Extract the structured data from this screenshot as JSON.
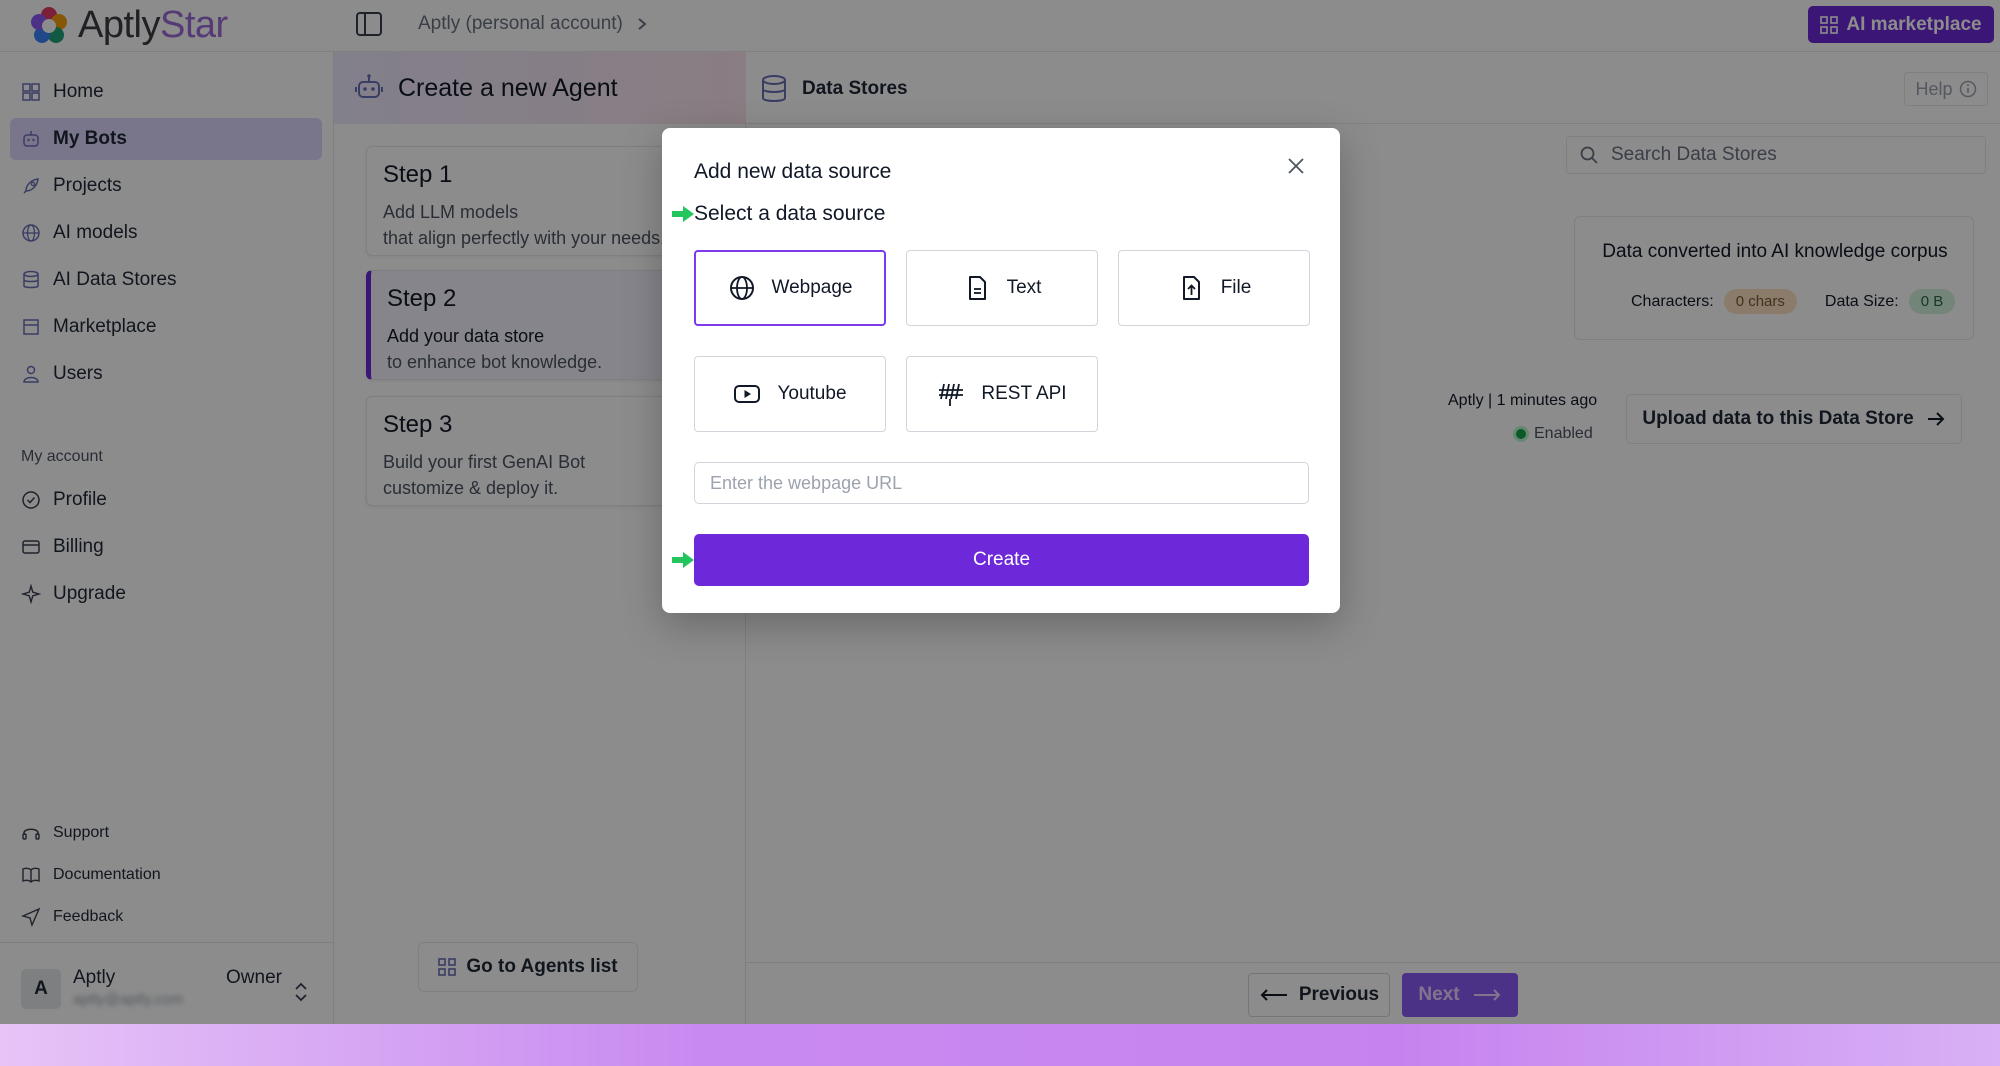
{
  "app": {
    "logo_text_main": "Aptly",
    "logo_text_accent": "Star",
    "breadcrumb": "Aptly (personal account)",
    "ai_marketplace_label": "AI marketplace"
  },
  "sidebar": {
    "items": [
      {
        "label": "Home",
        "icon": "home-icon"
      },
      {
        "label": "My Bots",
        "icon": "bot-icon",
        "active": true
      },
      {
        "label": "Projects",
        "icon": "rocket-icon"
      },
      {
        "label": "AI models",
        "icon": "globe-icon"
      },
      {
        "label": "AI Data Stores",
        "icon": "database-icon"
      },
      {
        "label": "Marketplace",
        "icon": "store-icon"
      },
      {
        "label": "Users",
        "icon": "user-icon"
      }
    ],
    "account_section_label": "My account",
    "account_items": [
      {
        "label": "Profile",
        "icon": "profile-icon"
      },
      {
        "label": "Billing",
        "icon": "card-icon"
      },
      {
        "label": "Upgrade",
        "icon": "sparkle-icon"
      }
    ],
    "footer_items": [
      {
        "label": "Support",
        "icon": "headset-icon"
      },
      {
        "label": "Documentation",
        "icon": "book-icon"
      },
      {
        "label": "Feedback",
        "icon": "send-icon"
      }
    ],
    "user": {
      "initial": "A",
      "name": "Aptly",
      "email": "aptly@aptly.com",
      "role": "Owner"
    }
  },
  "agent": {
    "header": "Create a new Agent",
    "steps": [
      {
        "title": "Step 1",
        "line1": "Add LLM models",
        "line2": "that align perfectly with your needs."
      },
      {
        "title": "Step 2",
        "line1": "Add your data store",
        "line2": "to enhance bot knowledge.",
        "active": true
      },
      {
        "title": "Step 3",
        "line1": "Build your first GenAI Bot",
        "line2": "customize & deploy it."
      }
    ],
    "go_to_list_label": "Go to Agents list"
  },
  "data_stores": {
    "title": "Data Stores",
    "help_label": "Help",
    "search_placeholder": "Search Data Stores",
    "corpus_title": "Data converted into AI knowledge corpus",
    "characters_label": "Characters:",
    "characters_value": "0 chars",
    "data_size_label": "Data Size:",
    "data_size_value": "0 B",
    "meta": "Aptly | 1 minutes ago",
    "status": "Enabled",
    "upload_label": "Upload data to this Data Store",
    "previous_label": "Previous",
    "next_label": "Next"
  },
  "modal": {
    "title": "Add new data source",
    "subtitle": "Select a data source",
    "sources": [
      {
        "label": "Webpage",
        "icon": "globe-icon",
        "selected": true
      },
      {
        "label": "Text",
        "icon": "document-icon"
      },
      {
        "label": "File",
        "icon": "file-upload-icon"
      },
      {
        "label": "Youtube",
        "icon": "youtube-icon"
      },
      {
        "label": "REST API",
        "icon": "api-icon"
      }
    ],
    "url_placeholder": "Enter the webpage URL",
    "url_value": "",
    "create_label": "Create"
  },
  "colors": {
    "accent": "#6d28d9",
    "selected_border": "#7c3aed",
    "hint_arrow": "#22c55e",
    "status_green": "#16a34a"
  }
}
